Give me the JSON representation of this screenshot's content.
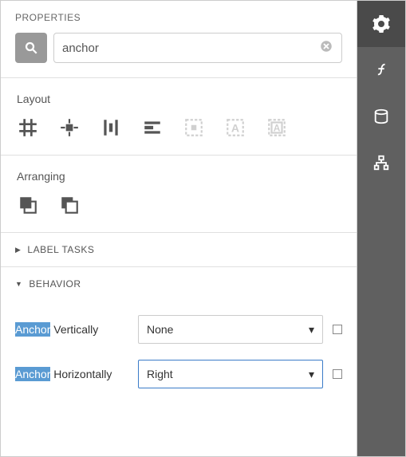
{
  "header": {
    "title": "PROPERTIES"
  },
  "search": {
    "value": "anchor"
  },
  "groups": {
    "layout": {
      "title": "Layout"
    },
    "arranging": {
      "title": "Arranging"
    }
  },
  "accordions": {
    "labelTasks": {
      "title": "LABEL TASKS"
    },
    "behavior": {
      "title": "BEHAVIOR"
    }
  },
  "behavior": {
    "anchorVertically": {
      "highlight": "Anchor",
      "rest": " Vertically",
      "value": "None"
    },
    "anchorHorizontally": {
      "highlight": "Anchor",
      "rest": " Horizontally",
      "value": "Right"
    }
  }
}
